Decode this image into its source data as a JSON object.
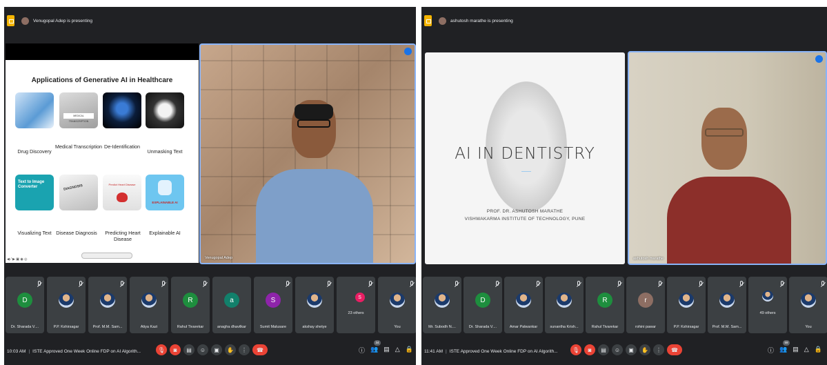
{
  "left": {
    "presenter_text": "Venugopal Adep is presenting",
    "slide": {
      "title": "Applications of Generative AI in Healthcare",
      "tiles": [
        {
          "label": "Drug Discovery",
          "image_text": ""
        },
        {
          "label": "Medical Transcription",
          "image_text": "MEDICAL TRANSCRIPTION"
        },
        {
          "label": "De-Identification",
          "image_text": ""
        },
        {
          "label": "Unmasking Text",
          "image_text": ""
        },
        {
          "label": "Visualizing Text",
          "image_text": "Text to Image Converter"
        },
        {
          "label": "Disease Diagnosis",
          "image_text": "DIAGNOSIS"
        },
        {
          "label": "Predicting Heart Disease",
          "image_text": "Predict Heart Disease"
        },
        {
          "label": "Explainable AI",
          "image_text": "EXPLAINABLE AI"
        }
      ]
    },
    "camera_label": "Venugopal Adep",
    "participants": [
      {
        "name": "Dr. Sharada V....",
        "initial": "D",
        "color": "#1e8e3e"
      },
      {
        "name": "P.P. Kshirsagar",
        "initial": "",
        "color": "#4285f4"
      },
      {
        "name": "Prof. M.M. Sam...",
        "initial": "",
        "color": "#3c8c3c"
      },
      {
        "name": "Atiya Kazi",
        "initial": "",
        "color": "#5b7db1"
      },
      {
        "name": "Rahul Tivarekar",
        "initial": "R",
        "color": "#1e8e3e"
      },
      {
        "name": "anagha dhavilkar",
        "initial": "a",
        "color": "#12806b"
      },
      {
        "name": "Sumit Malusare",
        "initial": "S",
        "color": "#8e24aa"
      },
      {
        "name": "akshay shetye",
        "initial": "",
        "color": "#5f6368"
      },
      {
        "name": "23 others",
        "initial": "S",
        "color": "#e91e63"
      },
      {
        "name": "You",
        "initial": "",
        "color": "#a0522d"
      }
    ],
    "time": "10:03 AM",
    "meeting": "ISTE Approved One Week Online FDP on AI Algorith...",
    "people_count": "34"
  },
  "right": {
    "presenter_text": "ashutosh marathe is presenting",
    "slide": {
      "title": "AI IN DENTISTRY",
      "author": "PROF. DR. ASHUTOSH MARATHE",
      "institute": "VISHWAKARMA INSTITUTE OF TECHNOLOGY, PUNE"
    },
    "camera_label": "ashutosh marathe",
    "participants": [
      {
        "name": "Mr. Subodh N....",
        "initial": "",
        "color": "#5b7db1"
      },
      {
        "name": "Dr. Sharada V....",
        "initial": "D",
        "color": "#1e8e3e"
      },
      {
        "name": "Amar Palwankar",
        "initial": "",
        "color": "#4a6fa5"
      },
      {
        "name": "sunantha Krish...",
        "initial": "",
        "color": "#8d6e63"
      },
      {
        "name": "Rahul Tivarekar",
        "initial": "R",
        "color": "#1e8e3e"
      },
      {
        "name": "rohini pawar",
        "initial": "r",
        "color": "#8d6e63"
      },
      {
        "name": "P.P. Kshirsagar",
        "initial": "",
        "color": "#4285f4"
      },
      {
        "name": "Prof. M.M. Sam...",
        "initial": "",
        "color": "#3c8c3c"
      },
      {
        "name": "49 others",
        "initial": "",
        "color": "#5b7db1"
      },
      {
        "name": "You",
        "initial": "",
        "color": "#a0522d"
      }
    ],
    "time": "11:41 AM",
    "meeting": "ISTE Approved One Week Online FDP on AI Algorith...",
    "people_count": "59"
  },
  "colors": {
    "meet_bg": "#202124",
    "tile_bg": "#3c4043",
    "end_call": "#ea4335",
    "presenter_border": "#8ab4f8"
  }
}
